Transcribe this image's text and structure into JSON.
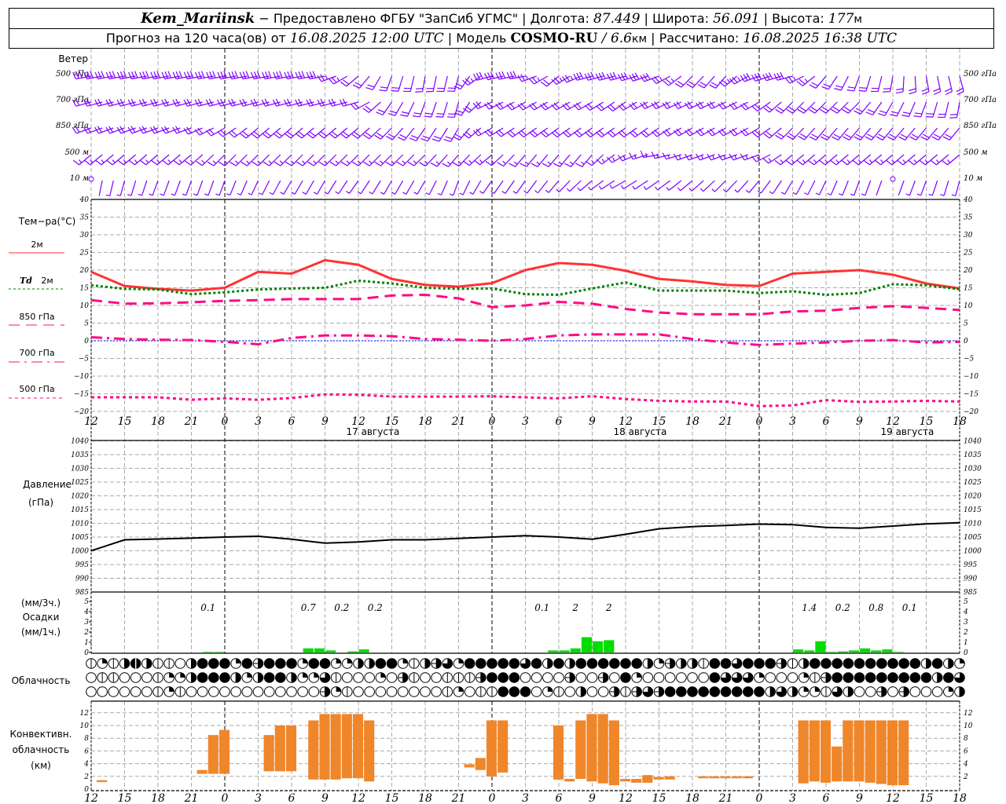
{
  "header": {
    "station": "Kem_Mariinsk",
    "provider": " − Предоставлено ФГБУ \"ЗапСиб УГМС\" | ",
    "lon_label": "Долгота: ",
    "lon": "87.449",
    "lat_label": " | Широта: ",
    "lat": "56.091",
    "alt_label": " | Высота: ",
    "alt": "177",
    "alt_unit": "м",
    "forecast_label": "Прогноз на 120 часа(ов) от ",
    "forecast_start": "16.08.2025 12:00 UTC",
    "model_label": "  | Модель ",
    "model": "COSMO-RU",
    "slash": " / ",
    "resolution": "6.6",
    "resolution_unit": "км",
    "computed_label": " | Рассчитано: ",
    "computed": "16.08.2025 16:38 UTC"
  },
  "time_axis": {
    "start": "2025-08-16T12:00Z",
    "ticks": [
      "12",
      "15",
      "18",
      "21",
      "0",
      "3",
      "6",
      "9",
      "12",
      "15",
      "18",
      "21",
      "0",
      "3",
      "6",
      "9",
      "12",
      "15",
      "18",
      "21",
      "0",
      "3",
      "6",
      "9",
      "12",
      "15",
      "18"
    ],
    "dates": [
      "17 августа",
      "18 августа",
      "19 августа"
    ]
  },
  "wind": {
    "title": "Ветер",
    "step_hours": 3,
    "units": "m/s",
    "levels": [
      {
        "label": "500 гПа",
        "dir": [
          260,
          260,
          260,
          260,
          260,
          260,
          260,
          260,
          230,
          200,
          190,
          195,
          255,
          260,
          230,
          255,
          255,
          250,
          225,
          220,
          250,
          255,
          220,
          200,
          190,
          170,
          165
        ],
        "speed": [
          15,
          15,
          15,
          15,
          15,
          15,
          15,
          15,
          12,
          10,
          10,
          10,
          15,
          15,
          12,
          15,
          15,
          15,
          12,
          12,
          15,
          15,
          12,
          10,
          10,
          10,
          10
        ]
      },
      {
        "label": "700 гПа",
        "dir": [
          255,
          255,
          255,
          255,
          255,
          255,
          255,
          255,
          255,
          215,
          200,
          195,
          245,
          240,
          240,
          240,
          235,
          245,
          245,
          245,
          240,
          225,
          225,
          225,
          210,
          200,
          190
        ],
        "speed": [
          12,
          12,
          12,
          12,
          12,
          12,
          12,
          12,
          12,
          10,
          10,
          10,
          12,
          12,
          12,
          12,
          12,
          12,
          12,
          12,
          12,
          10,
          10,
          10,
          10,
          10,
          10
        ]
      },
      {
        "label": "850 гПа",
        "dir": [
          250,
          250,
          250,
          250,
          240,
          230,
          230,
          230,
          230,
          225,
          215,
          210,
          240,
          235,
          235,
          235,
          235,
          235,
          240,
          240,
          240,
          225,
          220,
          220,
          220,
          220,
          220
        ],
        "speed": [
          10,
          10,
          10,
          10,
          10,
          10,
          10,
          10,
          10,
          10,
          10,
          10,
          10,
          10,
          10,
          10,
          10,
          10,
          10,
          10,
          10,
          10,
          10,
          10,
          10,
          10,
          10
        ]
      },
      {
        "label": "500 м",
        "dir": [
          230,
          230,
          230,
          230,
          225,
          225,
          225,
          225,
          225,
          225,
          225,
          220,
          230,
          220,
          220,
          220,
          240,
          260,
          250,
          250,
          250,
          230,
          230,
          230,
          230,
          230,
          230
        ],
        "speed": [
          8,
          8,
          8,
          8,
          8,
          8,
          8,
          8,
          8,
          8,
          8,
          8,
          8,
          8,
          8,
          8,
          8,
          8,
          8,
          8,
          8,
          8,
          8,
          8,
          8,
          8,
          8
        ]
      },
      {
        "label": "10 м",
        "dir": [
          190,
          195,
          200,
          200,
          200,
          205,
          210,
          210,
          215,
          210,
          210,
          200,
          215,
          215,
          220,
          230,
          240,
          235,
          230,
          225,
          220,
          210,
          205,
          200,
          200,
          200,
          195
        ],
        "speed": [
          0,
          4,
          4,
          4,
          4,
          4,
          4,
          4,
          4,
          4,
          4,
          4,
          4,
          4,
          4,
          4,
          4,
          4,
          4,
          4,
          4,
          4,
          4,
          4,
          0,
          4,
          4
        ]
      }
    ],
    "color": "#8000ff"
  },
  "temperature": {
    "title": "Тем−ра(°C)",
    "ylim": [
      -20,
      40
    ],
    "yticks": [
      -20,
      -15,
      -10,
      -5,
      0,
      5,
      10,
      15,
      20,
      25,
      30,
      35,
      40
    ],
    "step_hours": 3,
    "series": [
      {
        "name": "2м",
        "prefix": "",
        "color": "#ff3333",
        "style": "solid",
        "values": [
          19.5,
          15.5,
          14.7,
          14.2,
          15,
          19.5,
          19,
          22.8,
          21.5,
          17.5,
          15.8,
          15.3,
          16.3,
          20,
          22,
          21.5,
          19.8,
          17.5,
          16.8,
          15.8,
          15.5,
          19,
          19.5,
          20,
          18.7,
          16.2,
          14.8
        ]
      },
      {
        "name": "2м",
        "prefix": "Td",
        "color": "#008000",
        "style": "dotted",
        "values": [
          15.7,
          14.7,
          14.5,
          13.2,
          13.7,
          14.5,
          14.8,
          15,
          17,
          16.2,
          15,
          14.7,
          14.8,
          13.2,
          13,
          14.8,
          16.5,
          14.2,
          14.2,
          14.2,
          13.5,
          14,
          13,
          13.5,
          16,
          15.7,
          14.6
        ]
      },
      {
        "name": "850 гПа",
        "prefix": "",
        "color": "#ff0a84",
        "style": "dash",
        "values": [
          11.5,
          10.5,
          10.6,
          10.9,
          11.3,
          11.5,
          11.8,
          11.8,
          11.8,
          12.8,
          13,
          12,
          9.5,
          10,
          11,
          10.5,
          9,
          8,
          7.5,
          7.5,
          7.5,
          8.3,
          8.5,
          9.3,
          9.8,
          9.3,
          8.7
        ]
      },
      {
        "name": "700 гПа",
        "prefix": "",
        "color": "#ff0a84",
        "style": "dashdot",
        "values": [
          1,
          0.5,
          0.3,
          0.2,
          -0.3,
          -1,
          0.8,
          1.5,
          1.5,
          1.3,
          0.5,
          0.3,
          0,
          0.5,
          1.5,
          1.8,
          1.8,
          1.8,
          0.5,
          -0.5,
          -1.2,
          -0.8,
          -0.5,
          0,
          0.2,
          -0.5,
          -0.3
        ]
      },
      {
        "name": "500 гПа",
        "prefix": "",
        "color": "#ff0a84",
        "style": "dot",
        "values": [
          -16,
          -16,
          -16,
          -16.7,
          -16.3,
          -16.7,
          -16.2,
          -15.2,
          -15.3,
          -15.8,
          -15.8,
          -15.8,
          -15.7,
          -16,
          -16.3,
          -15.7,
          -16.5,
          -17,
          -17.2,
          -17.2,
          -18.5,
          -18.3,
          -16.8,
          -17.3,
          -17.2,
          -17,
          -17.2
        ]
      }
    ],
    "zero_line_color": "#0000ff"
  },
  "pressure": {
    "title": "Давление",
    "unit": "(гПа)",
    "ylim": [
      985,
      1040
    ],
    "yticks": [
      985,
      990,
      995,
      1000,
      1005,
      1010,
      1015,
      1020,
      1025,
      1030,
      1035,
      1040
    ],
    "step_hours": 3,
    "values": [
      1000,
      1004,
      1004.3,
      1004.6,
      1005,
      1005.3,
      1004.2,
      1002.8,
      1003.2,
      1004,
      1004,
      1004.5,
      1005,
      1005.5,
      1005,
      1004.2,
      1006,
      1008,
      1008.8,
      1009.2,
      1009.7,
      1009.5,
      1008.5,
      1008.2,
      1009,
      1009.8,
      1010.2
    ],
    "color": "#000000"
  },
  "precipitation": {
    "label_3h": "(мм/3ч.)",
    "title": "Осадки",
    "label_1h": "(мм/1ч.)",
    "ylim": [
      0,
      5
    ],
    "yticks": [
      0,
      1,
      2,
      3,
      4,
      5
    ],
    "color": "#00dd00",
    "hourly_start": "2025-08-16T13:00Z",
    "hourly_mm": [
      0,
      0,
      0,
      0,
      0,
      0,
      0,
      0,
      0,
      0,
      0.05,
      0.05,
      0,
      0,
      0,
      0,
      0,
      0,
      0,
      0.4,
      0.4,
      0.2,
      0,
      0.1,
      0.3,
      0,
      0,
      0,
      0,
      0,
      0,
      0,
      0,
      0,
      0,
      0,
      0,
      0,
      0,
      0,
      0,
      0.2,
      0.2,
      0.4,
      1.5,
      1.1,
      1.2,
      0,
      0,
      0,
      0,
      0,
      0,
      0,
      0,
      0,
      0,
      0,
      0,
      0,
      0,
      0,
      0,
      0.3,
      0.2,
      1.1,
      0.05,
      0.1,
      0.2,
      0.4,
      0.2,
      0.3,
      0.05,
      0,
      0,
      0,
      0,
      0
    ],
    "three_hour_totals": [
      null,
      null,
      null,
      "0.1",
      null,
      null,
      "0.7",
      "0.2",
      "0.2",
      null,
      null,
      null,
      null,
      "0.1",
      "2",
      "2",
      null,
      null,
      null,
      null,
      null,
      "1.4",
      "0.2",
      "0.8",
      "0.1",
      null
    ]
  },
  "cloudiness": {
    "title": "Облачность",
    "step_hours": 1,
    "rows": [
      [
        1,
        2,
        1,
        4,
        7,
        4,
        1,
        1,
        0,
        4,
        8,
        8,
        8,
        2,
        8,
        5,
        8,
        8,
        8,
        2,
        8,
        8,
        2,
        2,
        4,
        4,
        8,
        8,
        2,
        1,
        4,
        5,
        6,
        2,
        8,
        8,
        8,
        8,
        8,
        6,
        8,
        4,
        8,
        4,
        8,
        8,
        8,
        8,
        8,
        8,
        4,
        2,
        5,
        4,
        4,
        1,
        8,
        8,
        6,
        8,
        8,
        8,
        5,
        1,
        4,
        8,
        8,
        8,
        8,
        8,
        8,
        8,
        8,
        8,
        8,
        4,
        8,
        4,
        2
      ],
      [
        0,
        1,
        1,
        0,
        0,
        0,
        1,
        2,
        2,
        4,
        8,
        8,
        8,
        4,
        2,
        4,
        8,
        8,
        4,
        2,
        2,
        6,
        1,
        0,
        0,
        0,
        2,
        0,
        5,
        1,
        0,
        0,
        1,
        1,
        1,
        5,
        8,
        8,
        8,
        0,
        0,
        0,
        0,
        5,
        0,
        0,
        5,
        0,
        8,
        2,
        0,
        0,
        0,
        0,
        0,
        0,
        8,
        6,
        6,
        6,
        2,
        0,
        0,
        0,
        2,
        1,
        5,
        8,
        8,
        8,
        8,
        8,
        8,
        8,
        8,
        8,
        4,
        8,
        6
      ],
      [
        0,
        0,
        0,
        0,
        0,
        0,
        1,
        2,
        1,
        0,
        0,
        0,
        0,
        0,
        0,
        0,
        0,
        0,
        0,
        0,
        0,
        5,
        2,
        1,
        0,
        0,
        0,
        0,
        0,
        0,
        0,
        0,
        1,
        2,
        0,
        1,
        1,
        8,
        8,
        8,
        0,
        2,
        1,
        0,
        4,
        0,
        0,
        5,
        1,
        5,
        6,
        5,
        8,
        8,
        8,
        8,
        8,
        8,
        8,
        8,
        8,
        4,
        6,
        4,
        2,
        2,
        1,
        6,
        4,
        0,
        0,
        5,
        0,
        5,
        0,
        0,
        0,
        2,
        4
      ]
    ]
  },
  "convective": {
    "title_1": "Конвективн.",
    "title_2": "облачность",
    "unit": "(км)",
    "ylim": [
      0,
      13
    ],
    "yticks": [
      0,
      2,
      4,
      6,
      8,
      10,
      12
    ],
    "color": "#f0862a",
    "hourly_start": "2025-08-16T13:00Z",
    "base_top_km": [
      [
        1.1,
        1.4
      ],
      null,
      null,
      null,
      null,
      null,
      null,
      null,
      null,
      [
        2.4,
        3.0
      ],
      [
        2.4,
        8.5
      ],
      [
        2.4,
        9.3
      ],
      null,
      null,
      null,
      [
        2.8,
        8.5
      ],
      [
        2.8,
        10
      ],
      [
        2.8,
        10
      ],
      null,
      [
        1.5,
        10.8
      ],
      [
        1.5,
        11.8
      ],
      [
        1.5,
        11.8
      ],
      [
        1.7,
        11.8
      ],
      [
        1.7,
        11.8
      ],
      [
        1.2,
        10.8
      ],
      null,
      null,
      null,
      null,
      null,
      null,
      null,
      null,
      [
        3.4,
        3.9
      ],
      [
        3.0,
        4.9
      ],
      [
        2.0,
        10.8
      ],
      [
        2.6,
        10.8
      ],
      null,
      null,
      null,
      null,
      [
        1.5,
        10
      ],
      [
        1.2,
        1.6
      ],
      [
        1.6,
        10.8
      ],
      [
        1.2,
        11.8
      ],
      [
        0.9,
        11.8
      ],
      [
        0.6,
        10.8
      ],
      [
        1.2,
        1.6
      ],
      [
        1.0,
        1.6
      ],
      [
        1.0,
        2.2
      ],
      [
        1.5,
        1.9
      ],
      [
        1.5,
        2.0
      ],
      null,
      null,
      [
        1.7,
        2.0
      ],
      [
        1.7,
        2.0
      ],
      [
        1.7,
        2.0
      ],
      [
        1.7,
        2.0
      ],
      [
        1.7,
        2.0
      ],
      null,
      null,
      null,
      null,
      [
        0.9,
        10.8
      ],
      [
        1.2,
        10.8
      ],
      [
        1.0,
        10.8
      ],
      [
        1.2,
        6.7
      ],
      [
        1.2,
        10.8
      ],
      [
        1.2,
        10.8
      ],
      [
        1.0,
        10.8
      ],
      [
        0.8,
        10.8
      ],
      [
        0.6,
        10.8
      ],
      [
        0.6,
        10.8
      ],
      null,
      null,
      null,
      null,
      null
    ]
  },
  "chart_data": [
    {
      "type": "line",
      "title": "Тем−ра(°C)",
      "ref": "temperature"
    },
    {
      "type": "line",
      "title": "Давление",
      "ref": "pressure"
    },
    {
      "type": "bar",
      "title": "Осадки",
      "ref": "precipitation"
    },
    {
      "type": "table",
      "title": "Облачность",
      "ref": "cloudiness"
    },
    {
      "type": "bar",
      "title": "Конвективн. облачность",
      "ref": "convective"
    }
  ]
}
